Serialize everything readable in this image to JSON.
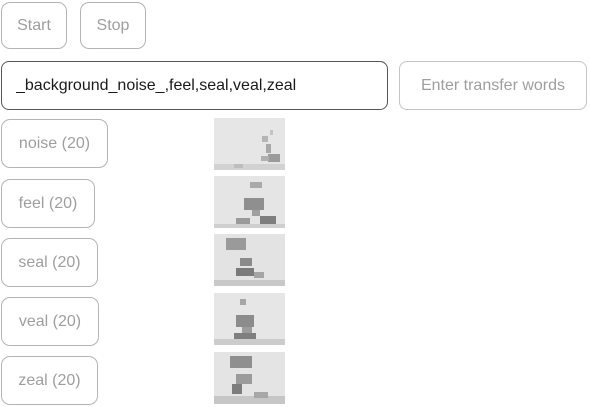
{
  "controls": {
    "start_label": "Start",
    "stop_label": "Stop"
  },
  "words_input": {
    "value": "_background_noise_,feel,seal,veal,zeal"
  },
  "transfer_input": {
    "placeholder": "Enter transfer words"
  },
  "words": [
    {
      "label": "noise (20)"
    },
    {
      "label": "feel (20)"
    },
    {
      "label": "seal (20)"
    },
    {
      "label": "veal (20)"
    },
    {
      "label": "zeal (20)"
    }
  ]
}
